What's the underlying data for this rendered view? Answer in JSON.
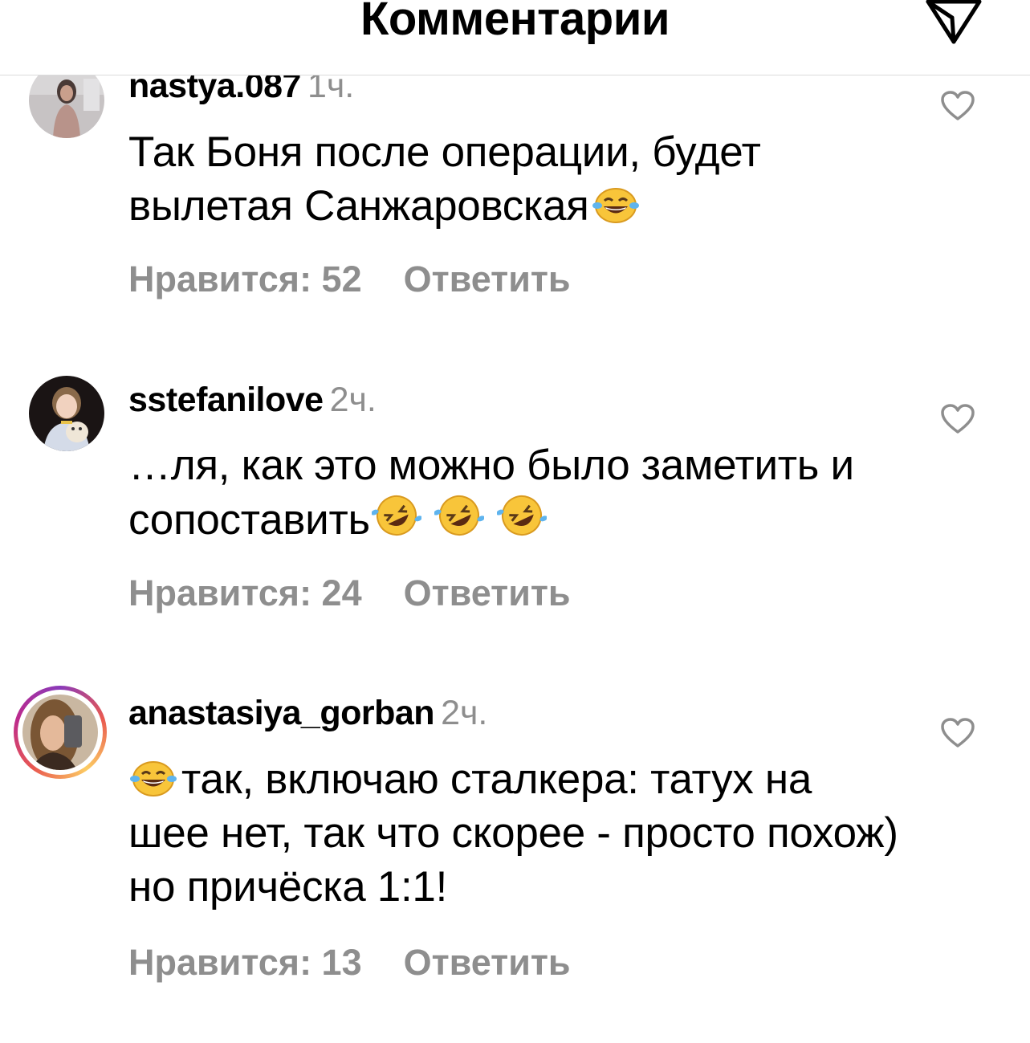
{
  "header": {
    "title": "Комментарии",
    "share_icon": "paper-plane-icon"
  },
  "comments": [
    {
      "username": "nastya.087",
      "time": "1ч.",
      "text": "Так Боня после операции, будет вылетая Санжаровская",
      "emoji": [
        "face-with-tears-of-joy"
      ],
      "likes_label": "Нравится: 52",
      "reply_label": "Ответить",
      "has_story_ring": false,
      "like_icon": "heart-icon"
    },
    {
      "username": "sstefanilove",
      "time": "2ч.",
      "text": "…ля, как это можно было заметить и сопоставить",
      "emoji": [
        "rolling-on-the-floor-laughing",
        "rolling-on-the-floor-laughing",
        "rolling-on-the-floor-laughing"
      ],
      "likes_label": "Нравится: 24",
      "reply_label": "Ответить",
      "has_story_ring": false,
      "like_icon": "heart-icon"
    },
    {
      "username": "anastasiya_gorban",
      "time": "2ч.",
      "text": "так, включаю сталкера: татух на шее нет, так что скорее - просто похож) но причёска 1:1!",
      "emoji": [
        "face-with-tears-of-joy"
      ],
      "likes_label": "Нравится: 13",
      "reply_label": "Ответить",
      "has_story_ring": true,
      "like_icon": "heart-icon"
    }
  ],
  "colors": {
    "secondary_text": "#8e8e8e",
    "divider": "#dbdbdb",
    "story_ring": [
      "#8a3ab9",
      "#e95950",
      "#fccc63",
      "#bc2a8d"
    ]
  }
}
